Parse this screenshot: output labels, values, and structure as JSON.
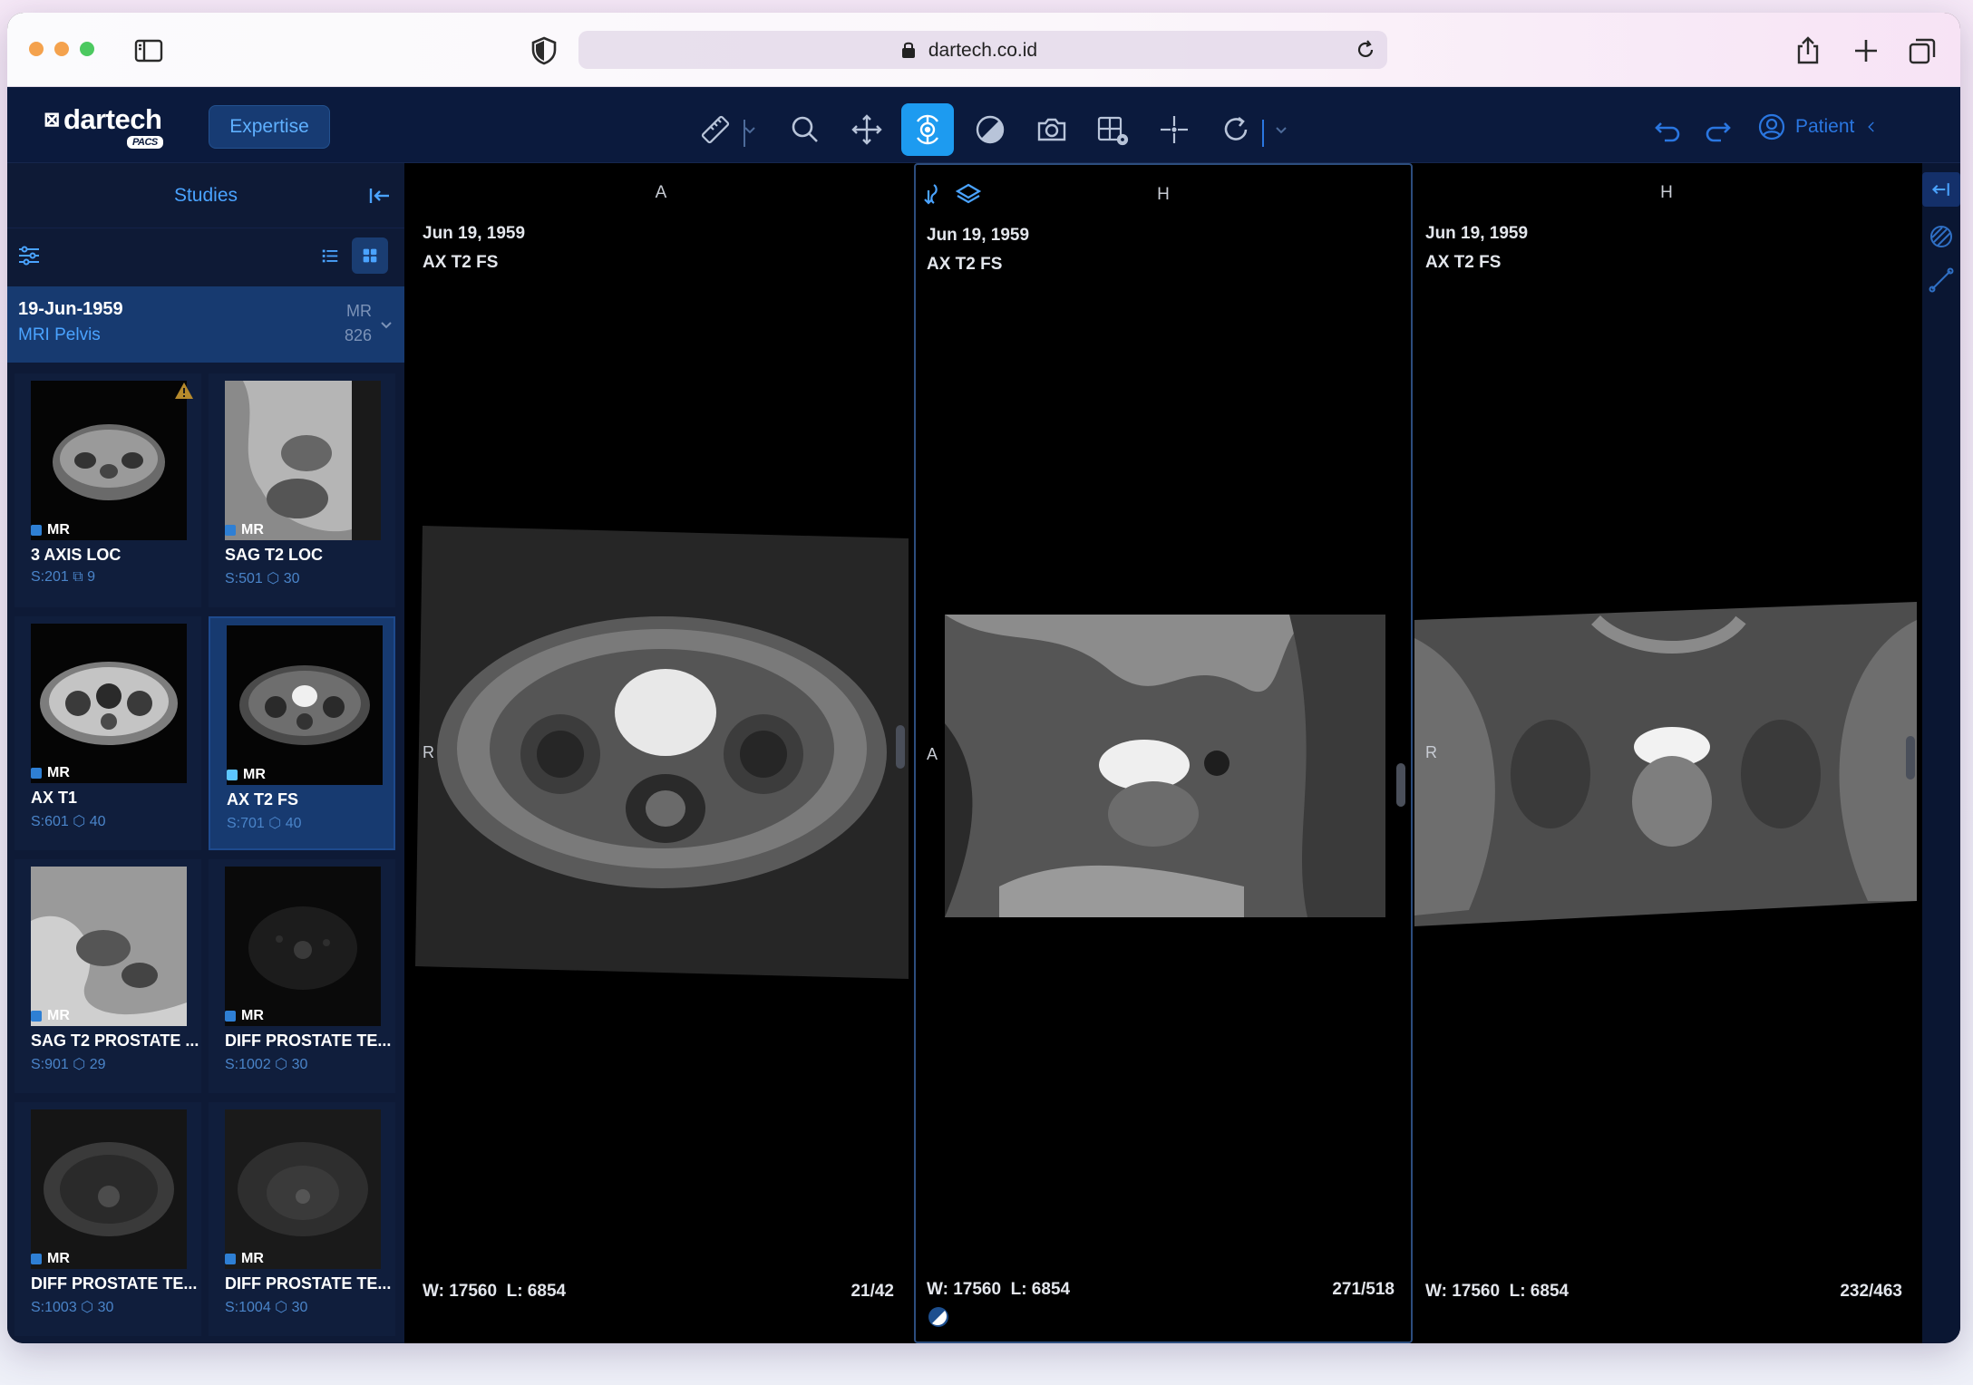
{
  "browser": {
    "url": "dartech.co.id",
    "traffic_colors": [
      "#f4a24d",
      "#f4a24d",
      "#4cc960"
    ]
  },
  "app": {
    "logo_text": "dartech",
    "logo_sub": "PACS",
    "mode_button": "Expertise",
    "patient_label": "Patient",
    "toolbar_icons": [
      "ruler-icon",
      "zoom-icon",
      "pan-icon",
      "crosshair-3d-icon",
      "contrast-icon",
      "camera-icon",
      "layout-grid-icon",
      "crosshair-icon",
      "rotate-icon",
      "undo-icon",
      "redo-icon"
    ],
    "active_tool": "crosshair-3d-icon",
    "accent": "#1d9bf0"
  },
  "sidebar": {
    "title": "Studies",
    "study": {
      "date": "19-Jun-1959",
      "description": "MRI Pelvis",
      "modality": "MR",
      "count": "826"
    },
    "series": [
      {
        "modality": "MR",
        "name": "3 AXIS LOC",
        "series_no": "S:201",
        "images": "9",
        "warning": true
      },
      {
        "modality": "MR",
        "name": "SAG T2 LOC",
        "series_no": "S:501",
        "images": "30"
      },
      {
        "modality": "MR",
        "name": "AX T1",
        "series_no": "S:601",
        "images": "40"
      },
      {
        "modality": "MR",
        "name": "AX T2 FS",
        "series_no": "S:701",
        "images": "40",
        "selected": true
      },
      {
        "modality": "MR",
        "name": "SAG T2 PROSTATE ...",
        "series_no": "S:901",
        "images": "29"
      },
      {
        "modality": "MR",
        "name": "DIFF PROSTATE TE...",
        "series_no": "S:1002",
        "images": "30"
      },
      {
        "modality": "MR",
        "name": "DIFF PROSTATE TE...",
        "series_no": "S:1003",
        "images": "30"
      },
      {
        "modality": "MR",
        "name": "DIFF PROSTATE TE...",
        "series_no": "S:1004",
        "images": "30"
      }
    ]
  },
  "viewports": [
    {
      "orient_top": "A",
      "orient_left": "R",
      "date": "Jun 19, 1959",
      "series": "AX T2 FS",
      "window": "W: 17560",
      "level": "L: 6854",
      "index": "21/42"
    },
    {
      "orient_top": "H",
      "orient_left": "A",
      "date": "Jun 19, 1959",
      "series": "AX T2 FS",
      "window": "W: 17560",
      "level": "L: 6854",
      "index": "271/518"
    },
    {
      "orient_top": "H",
      "orient_left": "R",
      "date": "Jun 19, 1959",
      "series": "AX T2 FS",
      "window": "W: 17560",
      "level": "L: 6854",
      "index": "232/463"
    }
  ]
}
